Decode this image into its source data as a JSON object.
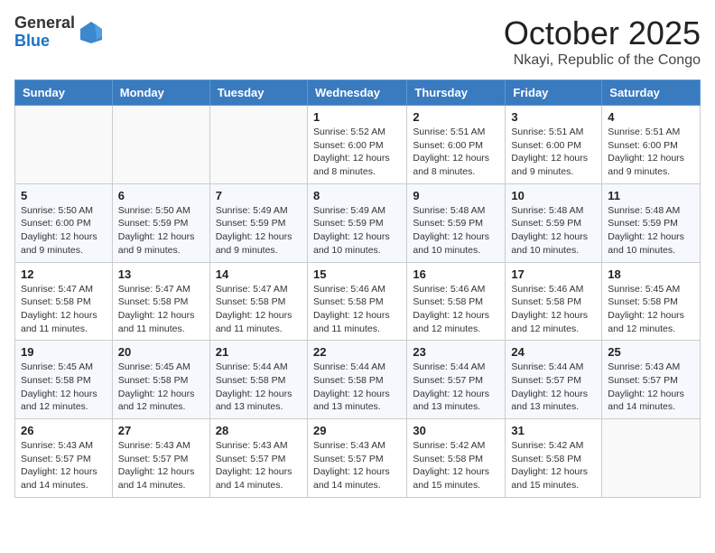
{
  "logo": {
    "general": "General",
    "blue": "Blue"
  },
  "title": "October 2025",
  "subtitle": "Nkayi, Republic of the Congo",
  "days": [
    "Sunday",
    "Monday",
    "Tuesday",
    "Wednesday",
    "Thursday",
    "Friday",
    "Saturday"
  ],
  "weeks": [
    [
      {
        "date": "",
        "sunrise": "",
        "sunset": "",
        "daylight": ""
      },
      {
        "date": "",
        "sunrise": "",
        "sunset": "",
        "daylight": ""
      },
      {
        "date": "",
        "sunrise": "",
        "sunset": "",
        "daylight": ""
      },
      {
        "date": "1",
        "sunrise": "Sunrise: 5:52 AM",
        "sunset": "Sunset: 6:00 PM",
        "daylight": "Daylight: 12 hours and 8 minutes."
      },
      {
        "date": "2",
        "sunrise": "Sunrise: 5:51 AM",
        "sunset": "Sunset: 6:00 PM",
        "daylight": "Daylight: 12 hours and 8 minutes."
      },
      {
        "date": "3",
        "sunrise": "Sunrise: 5:51 AM",
        "sunset": "Sunset: 6:00 PM",
        "daylight": "Daylight: 12 hours and 9 minutes."
      },
      {
        "date": "4",
        "sunrise": "Sunrise: 5:51 AM",
        "sunset": "Sunset: 6:00 PM",
        "daylight": "Daylight: 12 hours and 9 minutes."
      }
    ],
    [
      {
        "date": "5",
        "sunrise": "Sunrise: 5:50 AM",
        "sunset": "Sunset: 6:00 PM",
        "daylight": "Daylight: 12 hours and 9 minutes."
      },
      {
        "date": "6",
        "sunrise": "Sunrise: 5:50 AM",
        "sunset": "Sunset: 5:59 PM",
        "daylight": "Daylight: 12 hours and 9 minutes."
      },
      {
        "date": "7",
        "sunrise": "Sunrise: 5:49 AM",
        "sunset": "Sunset: 5:59 PM",
        "daylight": "Daylight: 12 hours and 9 minutes."
      },
      {
        "date": "8",
        "sunrise": "Sunrise: 5:49 AM",
        "sunset": "Sunset: 5:59 PM",
        "daylight": "Daylight: 12 hours and 10 minutes."
      },
      {
        "date": "9",
        "sunrise": "Sunrise: 5:48 AM",
        "sunset": "Sunset: 5:59 PM",
        "daylight": "Daylight: 12 hours and 10 minutes."
      },
      {
        "date": "10",
        "sunrise": "Sunrise: 5:48 AM",
        "sunset": "Sunset: 5:59 PM",
        "daylight": "Daylight: 12 hours and 10 minutes."
      },
      {
        "date": "11",
        "sunrise": "Sunrise: 5:48 AM",
        "sunset": "Sunset: 5:59 PM",
        "daylight": "Daylight: 12 hours and 10 minutes."
      }
    ],
    [
      {
        "date": "12",
        "sunrise": "Sunrise: 5:47 AM",
        "sunset": "Sunset: 5:58 PM",
        "daylight": "Daylight: 12 hours and 11 minutes."
      },
      {
        "date": "13",
        "sunrise": "Sunrise: 5:47 AM",
        "sunset": "Sunset: 5:58 PM",
        "daylight": "Daylight: 12 hours and 11 minutes."
      },
      {
        "date": "14",
        "sunrise": "Sunrise: 5:47 AM",
        "sunset": "Sunset: 5:58 PM",
        "daylight": "Daylight: 12 hours and 11 minutes."
      },
      {
        "date": "15",
        "sunrise": "Sunrise: 5:46 AM",
        "sunset": "Sunset: 5:58 PM",
        "daylight": "Daylight: 12 hours and 11 minutes."
      },
      {
        "date": "16",
        "sunrise": "Sunrise: 5:46 AM",
        "sunset": "Sunset: 5:58 PM",
        "daylight": "Daylight: 12 hours and 12 minutes."
      },
      {
        "date": "17",
        "sunrise": "Sunrise: 5:46 AM",
        "sunset": "Sunset: 5:58 PM",
        "daylight": "Daylight: 12 hours and 12 minutes."
      },
      {
        "date": "18",
        "sunrise": "Sunrise: 5:45 AM",
        "sunset": "Sunset: 5:58 PM",
        "daylight": "Daylight: 12 hours and 12 minutes."
      }
    ],
    [
      {
        "date": "19",
        "sunrise": "Sunrise: 5:45 AM",
        "sunset": "Sunset: 5:58 PM",
        "daylight": "Daylight: 12 hours and 12 minutes."
      },
      {
        "date": "20",
        "sunrise": "Sunrise: 5:45 AM",
        "sunset": "Sunset: 5:58 PM",
        "daylight": "Daylight: 12 hours and 12 minutes."
      },
      {
        "date": "21",
        "sunrise": "Sunrise: 5:44 AM",
        "sunset": "Sunset: 5:58 PM",
        "daylight": "Daylight: 12 hours and 13 minutes."
      },
      {
        "date": "22",
        "sunrise": "Sunrise: 5:44 AM",
        "sunset": "Sunset: 5:58 PM",
        "daylight": "Daylight: 12 hours and 13 minutes."
      },
      {
        "date": "23",
        "sunrise": "Sunrise: 5:44 AM",
        "sunset": "Sunset: 5:57 PM",
        "daylight": "Daylight: 12 hours and 13 minutes."
      },
      {
        "date": "24",
        "sunrise": "Sunrise: 5:44 AM",
        "sunset": "Sunset: 5:57 PM",
        "daylight": "Daylight: 12 hours and 13 minutes."
      },
      {
        "date": "25",
        "sunrise": "Sunrise: 5:43 AM",
        "sunset": "Sunset: 5:57 PM",
        "daylight": "Daylight: 12 hours and 14 minutes."
      }
    ],
    [
      {
        "date": "26",
        "sunrise": "Sunrise: 5:43 AM",
        "sunset": "Sunset: 5:57 PM",
        "daylight": "Daylight: 12 hours and 14 minutes."
      },
      {
        "date": "27",
        "sunrise": "Sunrise: 5:43 AM",
        "sunset": "Sunset: 5:57 PM",
        "daylight": "Daylight: 12 hours and 14 minutes."
      },
      {
        "date": "28",
        "sunrise": "Sunrise: 5:43 AM",
        "sunset": "Sunset: 5:57 PM",
        "daylight": "Daylight: 12 hours and 14 minutes."
      },
      {
        "date": "29",
        "sunrise": "Sunrise: 5:43 AM",
        "sunset": "Sunset: 5:57 PM",
        "daylight": "Daylight: 12 hours and 14 minutes."
      },
      {
        "date": "30",
        "sunrise": "Sunrise: 5:42 AM",
        "sunset": "Sunset: 5:58 PM",
        "daylight": "Daylight: 12 hours and 15 minutes."
      },
      {
        "date": "31",
        "sunrise": "Sunrise: 5:42 AM",
        "sunset": "Sunset: 5:58 PM",
        "daylight": "Daylight: 12 hours and 15 minutes."
      },
      {
        "date": "",
        "sunrise": "",
        "sunset": "",
        "daylight": ""
      }
    ]
  ]
}
